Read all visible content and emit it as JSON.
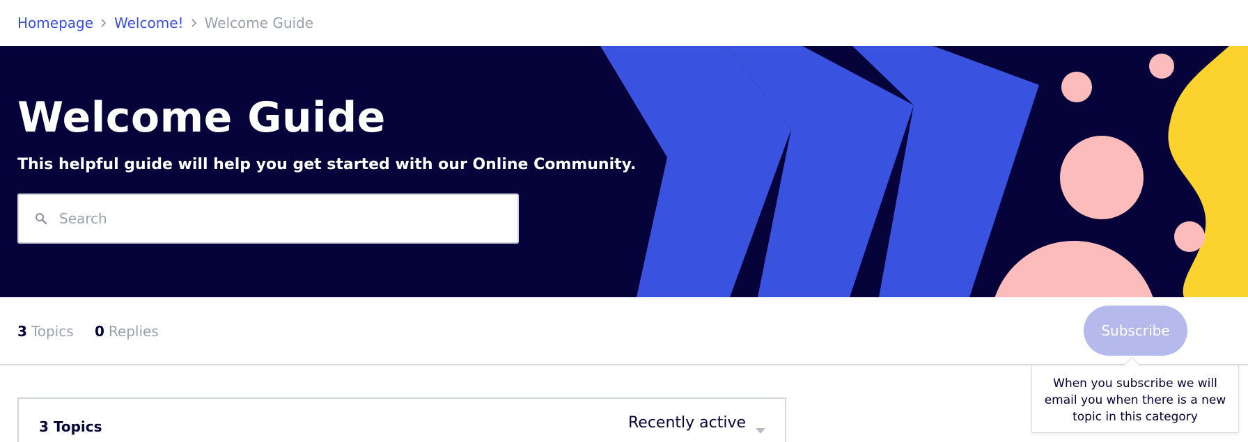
{
  "breadcrumb": {
    "items": [
      {
        "label": "Homepage"
      },
      {
        "label": "Welcome!"
      }
    ],
    "current": "Welcome Guide",
    "separator_icon": "chevron-right-icon"
  },
  "hero": {
    "title": "Welcome Guide",
    "subtitle": "This helpful guide will help you get started with our Online Community.",
    "background_color": "#06033a",
    "accent_blue": "#3a52e0",
    "accent_pink": "#fdbcbc",
    "accent_yellow": "#fcd22e"
  },
  "search": {
    "placeholder": "Search",
    "value": "",
    "icon": "search-icon"
  },
  "stats": {
    "topics_count": "3",
    "topics_label": "Topics",
    "replies_count": "0",
    "replies_label": "Replies"
  },
  "subscribe": {
    "label": "Subscribe",
    "color": "#b5b9ec"
  },
  "tooltip": {
    "text": "When you subscribe we will email you when there is a new topic in this category"
  },
  "topics_panel": {
    "heading": "3 Topics",
    "sort": {
      "selected": "Recently active",
      "icon": "caret-down-icon"
    }
  }
}
